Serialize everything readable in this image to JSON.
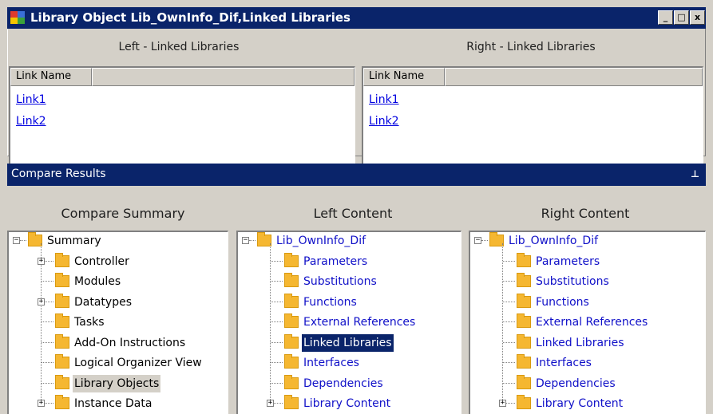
{
  "window": {
    "title": "Library Object Lib_OwnInfo_Dif,Linked Libraries",
    "buttons": {
      "minimize": "_",
      "maximize": "□",
      "close": "x"
    }
  },
  "left_pane": {
    "title": "Left - Linked Libraries",
    "columns": [
      "Link Name",
      ""
    ],
    "rows": [
      "Link1",
      "Link2"
    ]
  },
  "right_pane": {
    "title": "Right - Linked Libraries",
    "columns": [
      "Link Name",
      ""
    ],
    "rows": [
      "Link1",
      "Link2"
    ]
  },
  "compare_results": {
    "title": "Compare Results",
    "pin_icon": "pin-icon",
    "pin_glyph": "⊥",
    "summary": {
      "title": "Compare Summary",
      "root": "Summary",
      "items": [
        "Controller",
        "Modules",
        "Datatypes",
        "Tasks",
        "Add-On Instructions",
        "Logical Organizer View",
        "Library Objects",
        "Instance Data"
      ],
      "selected": "Library Objects"
    },
    "left_content": {
      "title": "Left Content",
      "root": "Lib_OwnInfo_Dif",
      "items": [
        "Parameters",
        "Substitutions",
        "Functions",
        "External References",
        "Linked Libraries",
        "Interfaces",
        "Dependencies",
        "Library Content"
      ],
      "selected": "Linked Libraries"
    },
    "right_content": {
      "title": "Right Content",
      "root": "Lib_OwnInfo_Dif",
      "items": [
        "Parameters",
        "Substitutions",
        "Functions",
        "External References",
        "Linked Libraries",
        "Interfaces",
        "Dependencies",
        "Library Content"
      ]
    }
  },
  "tree_glyphs": {
    "collapse": "−",
    "expand": "+"
  },
  "colors": {
    "titlebar": "#0a246a",
    "link": "#0000e0",
    "content_text": "#1010c8",
    "folder": "#f5b731"
  }
}
